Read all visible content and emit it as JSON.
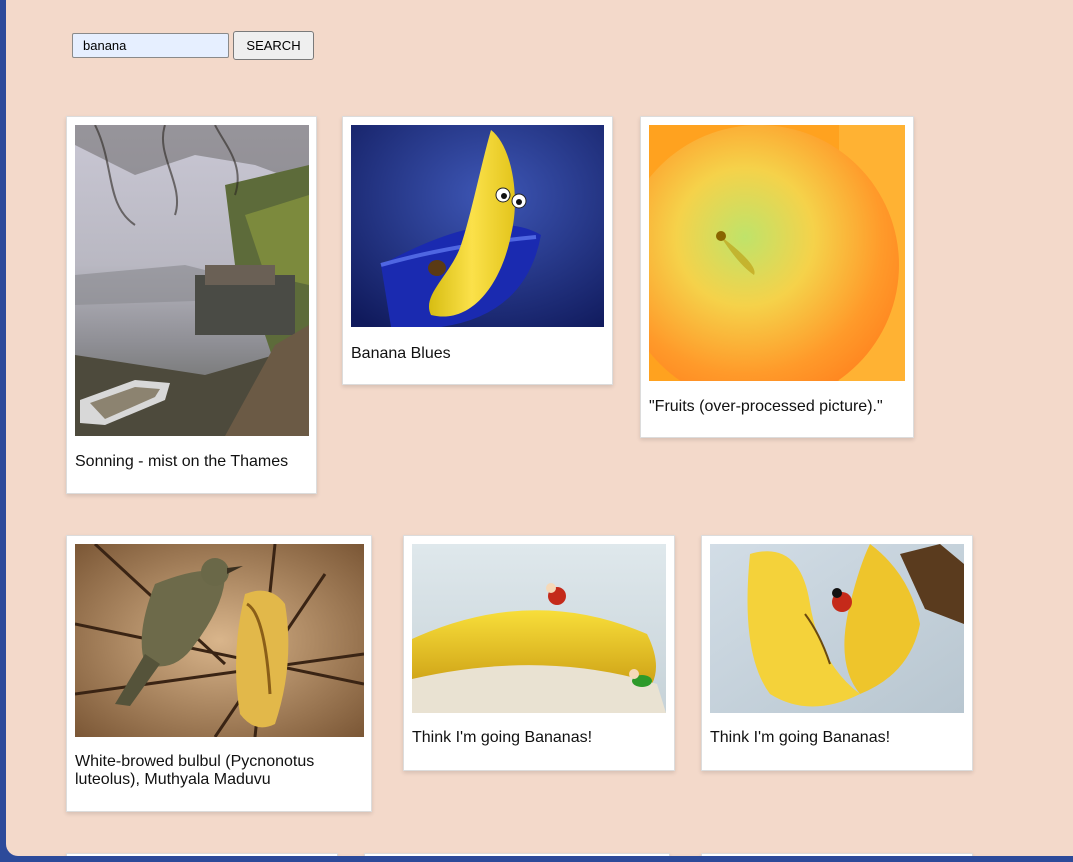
{
  "search": {
    "value": "banana",
    "button_label": "SEARCH"
  },
  "results": [
    {
      "title": "Sonning - mist on the Thames"
    },
    {
      "title": "Banana Blues"
    },
    {
      "title": "\"Fruits (over-processed picture).\""
    },
    {
      "title": "White-browed bulbul (Pycnonotus luteolus), Muthyala Maduvu"
    },
    {
      "title": "Think I'm going Bananas!"
    },
    {
      "title": "Think I'm going Bananas!"
    }
  ],
  "colors": {
    "page_background": "#f3d9ca",
    "card_background": "#ffffff",
    "desktop": "#2c4a9a"
  }
}
